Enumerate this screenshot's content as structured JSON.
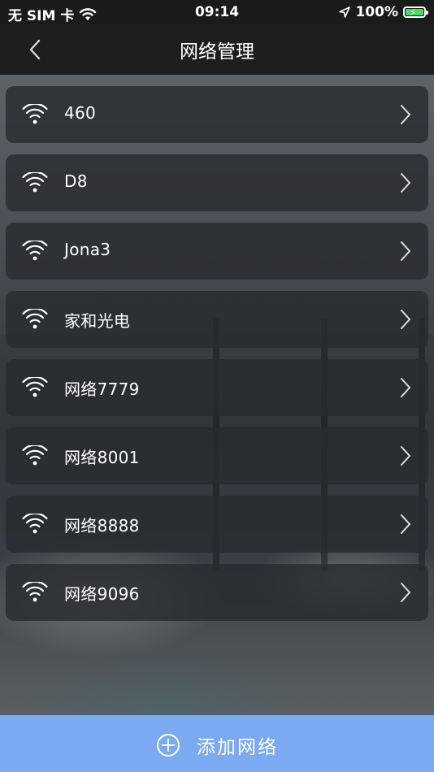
{
  "status_bar": {
    "carrier": "无 SIM 卡",
    "time": "09:14",
    "battery": "100%",
    "icons": [
      "wifi-icon",
      "location-arrow-icon",
      "battery-charging-icon"
    ]
  },
  "nav": {
    "title": "网络管理",
    "back_icon": "chevron-left-icon"
  },
  "networks": [
    {
      "name": "460"
    },
    {
      "name": "D8"
    },
    {
      "name": "Jona3"
    },
    {
      "name": "家和光电"
    },
    {
      "name": "网络7779"
    },
    {
      "name": "网络8001"
    },
    {
      "name": "网络8888"
    },
    {
      "name": "网络9096"
    }
  ],
  "add_button": {
    "label": "添加网络",
    "icon": "plus-circle-icon",
    "color": "#7baaf3"
  },
  "colors": {
    "navbar": "#1e1e1e",
    "row_background": "#282b2e",
    "battery_fill": "#4cd964"
  }
}
